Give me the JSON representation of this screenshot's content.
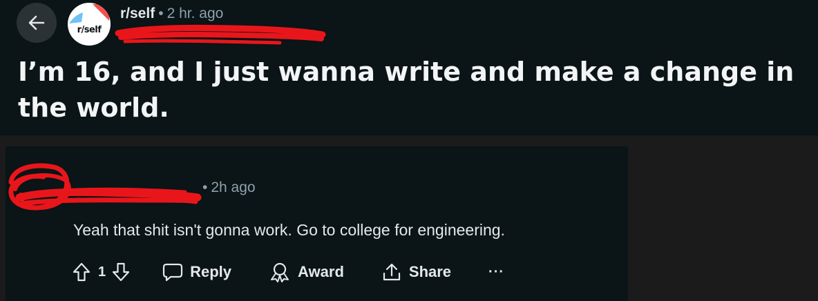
{
  "post": {
    "subreddit": "r/self",
    "avatar_text": "r/self",
    "separator": "•",
    "time": "2 hr. ago",
    "title": "I’m 16, and I just wanna write and make a change in the world."
  },
  "comment": {
    "separator": "•",
    "time": "2h ago",
    "body": "Yeah that shit isn't gonna work. Go to college for engineering.",
    "score": "1",
    "reply_label": "Reply",
    "award_label": "Award",
    "share_label": "Share",
    "more_label": "···"
  },
  "colors": {
    "page_bg": "#1b1b1b",
    "card_bg": "#0b1416",
    "redaction": "#e8161b"
  },
  "icons": [
    "back-arrow-icon",
    "upvote-icon",
    "downvote-icon",
    "comment-icon",
    "award-icon",
    "share-icon",
    "more-icon"
  ]
}
